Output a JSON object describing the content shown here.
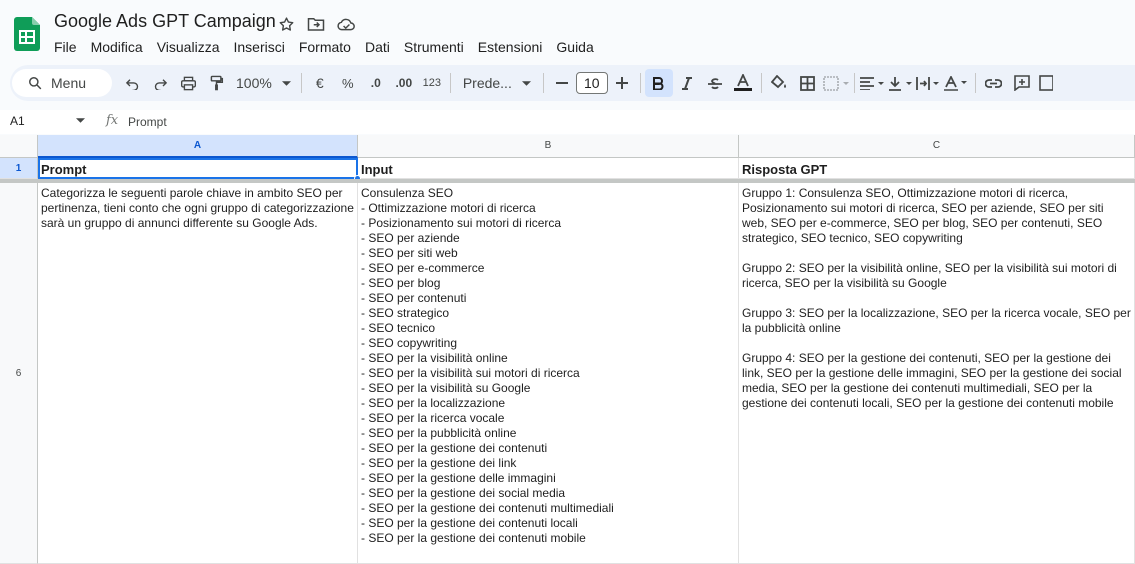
{
  "app": {
    "title": "Google Ads GPT Campaign",
    "accent": "#0b57d0",
    "logo_color": "#0f9d58"
  },
  "menu": [
    "File",
    "Modifica",
    "Visualizza",
    "Inserisci",
    "Formato",
    "Dati",
    "Strumenti",
    "Estensioni",
    "Guida"
  ],
  "toolbar": {
    "search_label": "Menu",
    "zoom": "100%",
    "currency": "€",
    "percent": "%",
    "decrease_decimal": ".0",
    "increase_decimal": ".00",
    "number_format": "123",
    "font": "Prede...",
    "font_size": "10"
  },
  "formula_bar": {
    "cell_ref": "A1",
    "fx": "fx",
    "value": "Prompt"
  },
  "sheet": {
    "columns": [
      "A",
      "B",
      "C"
    ],
    "rows": [
      "1",
      "6"
    ],
    "header": {
      "a": "Prompt",
      "b": "Input",
      "c": "Risposta GPT"
    },
    "row6": {
      "a": "Categorizza le seguenti parole chiave in ambito SEO per pertinenza, tieni conto che ogni gruppo di categorizzazione sarà un gruppo di annunci differente su Google Ads.",
      "b": [
        "Consulenza SEO",
        "- Ottimizzazione motori di ricerca",
        "- Posizionamento sui motori di ricerca",
        "- SEO per aziende",
        "- SEO per siti web",
        "- SEO per e-commerce",
        "- SEO per blog",
        "- SEO per contenuti",
        "- SEO strategico",
        "- SEO tecnico",
        "- SEO copywriting",
        "- SEO per la visibilità online",
        "- SEO per la visibilità sui motori di ricerca",
        "- SEO per la visibilità su Google",
        "- SEO per la localizzazione",
        "- SEO per la ricerca vocale",
        "- SEO per la pubblicità online",
        "- SEO per la gestione dei contenuti",
        "- SEO per la gestione dei link",
        "- SEO per la gestione delle immagini",
        "- SEO per la gestione dei social media",
        "- SEO per la gestione dei contenuti multimediali",
        "- SEO per la gestione dei contenuti locali",
        "- SEO per la gestione dei contenuti mobile"
      ],
      "c": [
        "Gruppo 1: Consulenza SEO, Ottimizzazione motori di ricerca, Posizionamento sui motori di ricerca, SEO per aziende, SEO per siti web, SEO per e-commerce, SEO per blog, SEO per contenuti, SEO strategico, SEO tecnico, SEO copywriting",
        "Gruppo 2: SEO per la visibilità online, SEO per la visibilità sui motori di ricerca, SEO per la visibilità su Google",
        "Gruppo 3: SEO per la localizzazione, SEO per la ricerca vocale, SEO per la pubblicità online",
        "Gruppo 4: SEO per la gestione dei contenuti, SEO per la gestione dei link, SEO per la gestione delle immagini, SEO per la gestione dei social media, SEO per la gestione dei contenuti multimediali, SEO per la gestione dei contenuti locali, SEO per la gestione dei contenuti mobile"
      ]
    }
  }
}
